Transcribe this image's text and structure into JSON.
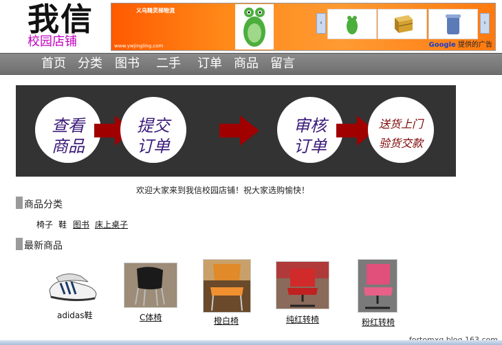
{
  "logo": {
    "main": "我信",
    "sub": "校园店铺"
  },
  "ad": {
    "title": "义乌精灵梯物流",
    "url": "www.ywjingling.com",
    "google_label": "Google",
    "google_suffix": "提供的广告",
    "prev_arrow": "‹",
    "next_arrow": "›"
  },
  "nav": {
    "items": [
      "首页",
      "分类",
      "图书",
      "二手",
      "订单",
      "商品",
      "留言"
    ]
  },
  "banner": {
    "steps": [
      {
        "line1": "查看",
        "line2": "商品"
      },
      {
        "line1": "提交",
        "line2": "订单"
      },
      {
        "line1": "审核",
        "line2": "订单"
      },
      {
        "line1": "送货上门",
        "line2": "验货交款"
      }
    ],
    "colors": {
      "background": "#333333",
      "arrow": "#a00000",
      "text": "#3b1a7a"
    }
  },
  "welcome": "欢迎大家来到我信校园店铺！祝大家选购愉快！",
  "categories": {
    "title": "商品分类",
    "items": [
      "椅子",
      "鞋",
      "图书",
      "床上桌子"
    ]
  },
  "latest": {
    "title": "最新商品",
    "products": [
      {
        "name": "adidas鞋",
        "icon": "sneaker-image"
      },
      {
        "name": "C体椅",
        "icon": "chair-image"
      },
      {
        "name": "橙白椅",
        "icon": "chair-image"
      },
      {
        "name": "纯红转椅",
        "icon": "chair-image"
      },
      {
        "name": "粉红转椅",
        "icon": "chair-image"
      }
    ]
  },
  "footer": {
    "credit": "fortomxq.blog.163.com"
  }
}
